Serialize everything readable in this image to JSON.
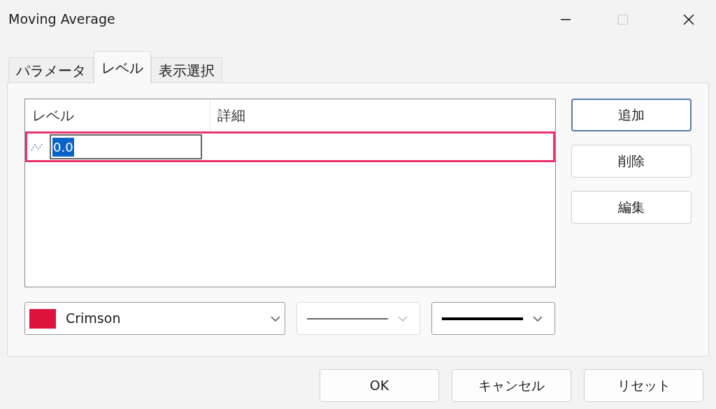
{
  "window": {
    "title": "Moving Average",
    "maximize_disabled": true
  },
  "tabs": [
    {
      "label": "パラメータ",
      "selected": false
    },
    {
      "label": "レベル",
      "selected": true
    },
    {
      "label": "表示選択",
      "selected": false
    }
  ],
  "table": {
    "columns": [
      "レベル",
      "詳細"
    ],
    "rows": [
      {
        "value": "0.0",
        "editing": true,
        "highlighted": true
      }
    ]
  },
  "side_buttons": [
    {
      "label": "追加",
      "selected": true
    },
    {
      "label": "削除",
      "selected": false
    },
    {
      "label": "編集",
      "selected": false
    }
  ],
  "color_select": {
    "value": "Crimson",
    "color": "#dc143c"
  },
  "style_select": {
    "disabled": true
  },
  "width_select": {
    "disabled": false
  },
  "footer_buttons": [
    "OK",
    "キャンセル",
    "リセット"
  ]
}
